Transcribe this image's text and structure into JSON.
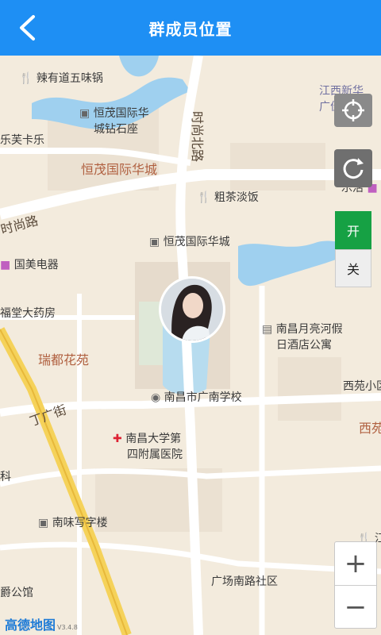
{
  "header": {
    "title": "群成员位置"
  },
  "map": {
    "labels": {
      "la_you_dao": "辣有道五味锅",
      "hengmao_zuanshi_1": "恒茂国际华",
      "hengmao_zuanshi_2": "城钻石座",
      "lefu_kale": "乐芙卡乐",
      "hengmao_road": "恒茂国际华城",
      "cu_cha": "粗茶淡饭",
      "shishang_north": "时尚北路",
      "shishang_road": "时尚路",
      "hengmao_small": "恒茂国际华城",
      "guomei": "国美电器",
      "futang": "福堂大药房",
      "ruidu": "瑞都花苑",
      "yueliang_1": "南昌月亮河假",
      "yueliang_2": "日酒店公寓",
      "guangnan": "南昌市广南学校",
      "xiyuan": "西苑小区",
      "xi": "西苑",
      "dingguang": "丁广街",
      "hospital_1": "南昌大学第",
      "hospital_2": "四附属医院",
      "ke": "科",
      "nanwei": "南味写字楼",
      "guangchang": "广场南路社区",
      "jue": "爵公馆",
      "jiangxi_1": "江西新华",
      "jiangxi_2": "广佳小",
      "lehuo": "乐活",
      "jiang": "江"
    },
    "logo": "高德地图",
    "logo_version": "V3.4.8"
  },
  "controls": {
    "on_label": "开",
    "off_label": "关",
    "zoom_in": "+",
    "zoom_out": "−"
  },
  "colors": {
    "header": "#1e8ff4",
    "on": "#16a144",
    "water": "#9fd0ef",
    "road": "#ffffff",
    "main_road": "#f5d25a"
  }
}
